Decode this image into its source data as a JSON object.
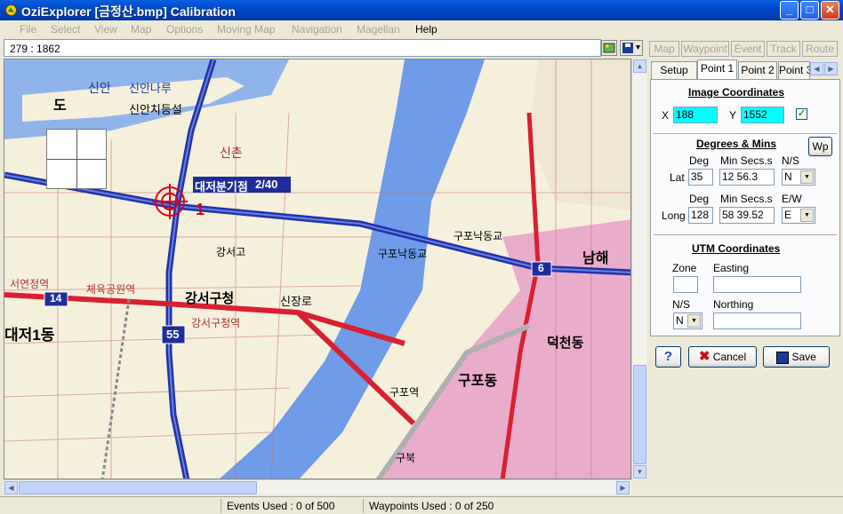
{
  "window": {
    "title": "OziExplorer [금정산.bmp] Calibration"
  },
  "menu": [
    {
      "label": "File",
      "enabled": false
    },
    {
      "label": "Select",
      "enabled": false
    },
    {
      "label": "View",
      "enabled": false
    },
    {
      "label": "Map",
      "enabled": false
    },
    {
      "label": "Options",
      "enabled": false
    },
    {
      "label": "Moving Map",
      "enabled": false
    },
    {
      "label": "Navigation",
      "enabled": false
    },
    {
      "label": "Magellan",
      "enabled": false
    },
    {
      "label": "Help",
      "enabled": true
    }
  ],
  "toolbar": {
    "coordinates": "279 : 1862",
    "tabs": [
      "Map",
      "Waypoint",
      "Event",
      "Track",
      "Route"
    ]
  },
  "map": {
    "labels": {
      "sinan": "신안",
      "sinan_naru": "신안나루",
      "sinan_chideungseol": "신안치등설",
      "do": "도",
      "sinchon": "신촌",
      "daejeo_bungijeom": "대저분기점",
      "daejeo_num": "2/40",
      "gangseo_go": "강서고",
      "gangseo_gu": "강서구청",
      "gangseo_gu_station": "강서구청역",
      "sinpyeong": "신장로",
      "gupo_bridge": "구포낙동교",
      "gupo_bridge2": "구포낙동교",
      "gupo_dong": "구포동",
      "gupo_station": "구포역",
      "daejeo1": "대저1동",
      "sportscomplex": "체육공원역",
      "seoyeon": "서연정역",
      "deokcheon": "덕천동",
      "namhae": "남해",
      "route14": "14",
      "route55": "55",
      "route6": "6",
      "gubuk": "구북"
    }
  },
  "panel": {
    "tabs": [
      "Setup",
      "Point 1",
      "Point 2",
      "Point 3"
    ],
    "active_tab": "Point 1",
    "image_coordinates": {
      "heading": "Image Coordinates",
      "x_label": "X",
      "x_value": "188",
      "y_label": "Y",
      "y_value": "1552",
      "checked": true
    },
    "degrees_mins": {
      "heading": "Degrees & Mins",
      "wp_button": "Wp",
      "col_deg": "Deg",
      "col_min": "Min Secs.s",
      "col_ns": "N/S",
      "col_ew": "E/W",
      "lat_label": "Lat",
      "lat_deg": "35",
      "lat_min": "12 56.3",
      "lat_ns": "N",
      "long_label": "Long",
      "long_deg": "128",
      "long_min": "58 39.52",
      "long_ew": "E"
    },
    "utm": {
      "heading": "UTM Coordinates",
      "zone_label": "Zone",
      "easting_label": "Easting",
      "ns_label": "N/S",
      "northing_label": "Northing",
      "ns_value": "N"
    },
    "buttons": {
      "help": "?",
      "cancel": "Cancel",
      "save": "Save"
    }
  },
  "status": {
    "events": "Events Used : 0 of 500",
    "waypoints": "Waypoints Used : 0 of 250"
  },
  "colors": {
    "titlebar": "#0048c8",
    "river": "#6f9be8",
    "highway_blue": "#2233aa",
    "road_red": "#d82030",
    "urban_pink": "#e8a0c8",
    "highlight_cyan": "#00ffff"
  }
}
